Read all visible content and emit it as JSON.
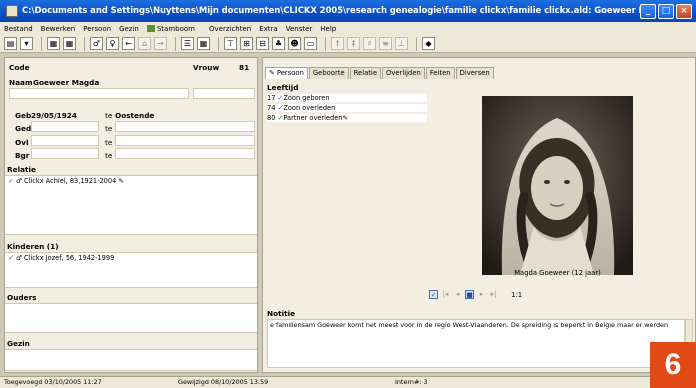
{
  "window": {
    "title": "C:\\Documents and Settings\\Nuyttens\\Mijn documenten\\CLICKX 2005\\research genealogie\\familie clickx\\familie clickx.ald: Goeweer Magda"
  },
  "menu": [
    "Bestand",
    "Bewerken",
    "Persoon",
    "Gezin",
    "Stamboom",
    "Overzichten",
    "Extra",
    "Venster",
    "Help"
  ],
  "person": {
    "code_label": "Code",
    "gender_label": "Vrouw",
    "code_value": "81",
    "name_label": "Naam",
    "name_value": "Goeweer Magda",
    "geb_label": "Geb",
    "geb_date": "29/05/1924",
    "geb_te_label": "te",
    "geb_place": "Oostende",
    "ged_label": "Ged",
    "ged_te": "te",
    "ovl_label": "Ovl",
    "ovl_te": "te",
    "bgr_label": "Bgr",
    "bgr_te": "te"
  },
  "sections": {
    "relatie": {
      "title": "Relatie",
      "items": [
        "Clickx Achiel, 83,1921-2004"
      ]
    },
    "kinderen": {
      "title": "Kinderen (1)",
      "items": [
        "Clickx Jozef, 56, 1942-1999"
      ]
    },
    "ouders": {
      "title": "Ouders"
    },
    "gezin": {
      "title": "Gezin"
    }
  },
  "tabs": [
    "Persoon",
    "Geboorte",
    "Relatie",
    "Overlijden",
    "Feiten",
    "Diversen"
  ],
  "leeftijd": {
    "title": "Leeftijd",
    "events": [
      {
        "age": "17",
        "label": "Zoon geboren"
      },
      {
        "age": "74",
        "label": "Zoon overleden"
      },
      {
        "age": "80",
        "label": "Partner overleden"
      }
    ]
  },
  "photo": {
    "caption": "Magda Goeweer (12 jaar)",
    "scale": "1:1"
  },
  "notitie": {
    "title": "Notitie",
    "text": "e familiensam Goeweer komt het meest voor in de regio West-Vlaanderen. De spreiding is beperkt in Belgie maar er werden"
  },
  "status": {
    "added": "Toegevoegd 03/10/2005 11:27",
    "modified": "Gewijzigd 08/10/2005 13:59",
    "intern": "Intern#: 3"
  },
  "badge": "6",
  "colors": {
    "titlebar": "#0b4fc6",
    "panel": "#f2efe2",
    "badge": "#e14a17"
  }
}
